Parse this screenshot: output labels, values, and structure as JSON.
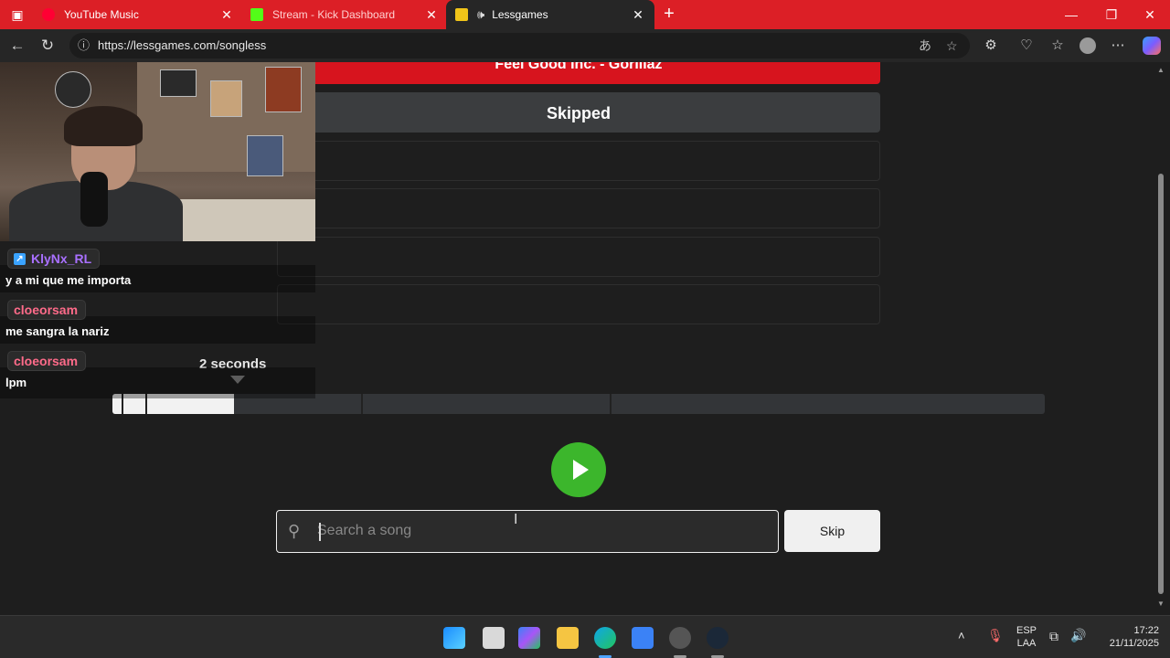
{
  "browser": {
    "tabs": [
      {
        "title": "YouTube Music",
        "favicon_color": "#ff0033"
      },
      {
        "title": "Stream - Kick Dashboard",
        "favicon_color": "#53fc18"
      },
      {
        "title": "Lessgames",
        "favicon_color": "#f0c419"
      }
    ],
    "url": "https://lessgames.com/songless"
  },
  "game": {
    "guesses": [
      {
        "status": "wrong",
        "text": "Feel Good Inc. - Gorillaz"
      },
      {
        "status": "skipped",
        "text": "Skipped"
      },
      {
        "status": "empty",
        "text": ""
      },
      {
        "status": "empty",
        "text": ""
      },
      {
        "status": "empty",
        "text": ""
      },
      {
        "status": "empty",
        "text": ""
      }
    ],
    "time_label": "2 seconds",
    "progress_fraction": 0.13,
    "search_placeholder": "Search a song",
    "skip_label": "Skip"
  },
  "chat": [
    {
      "user": "KlyNx_RL",
      "message": "y a mi que me importa"
    },
    {
      "user": "cloeorsam",
      "message": "me sangra la nariz"
    },
    {
      "user": "cloeorsam",
      "message": "lpm"
    }
  ],
  "taskbar": {
    "lang_top": "ESP",
    "lang_bottom": "LAA",
    "time": "17:22",
    "date": "21/11/2025"
  }
}
